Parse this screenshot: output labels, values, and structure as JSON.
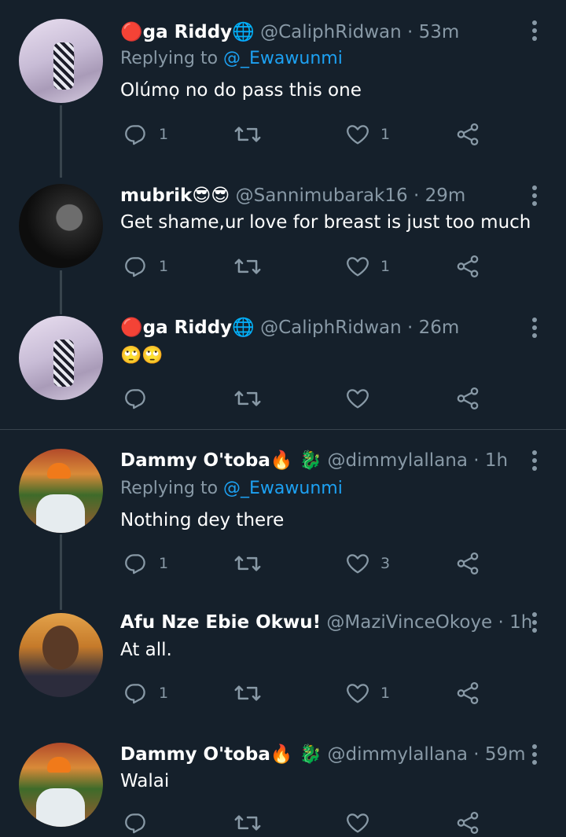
{
  "tweets": [
    {
      "name": "🔴ga Riddy🌐",
      "handle": "@CaliphRidwan",
      "time": "· 53m",
      "replying_label": "Replying to",
      "replying_to": "@_Ewawunmi",
      "text": "Olúmọ no do pass this one",
      "replies": "1",
      "retweets": "",
      "likes": "1"
    },
    {
      "name": "mubrik😎😎",
      "handle": "@Sannimubarak16",
      "time": "· 29m",
      "text": "Get shame,ur love for breast is just too much",
      "replies": "1",
      "retweets": "",
      "likes": "1"
    },
    {
      "name": "🔴ga Riddy🌐",
      "handle": "@CaliphRidwan",
      "time": "· 26m",
      "text": "🙄🙄",
      "replies": "",
      "retweets": "",
      "likes": ""
    },
    {
      "name": "Dammy O'toba🔥 🐉",
      "handle": "@dimmylallana",
      "time": "· 1h",
      "replying_label": "Replying to",
      "replying_to": "@_Ewawunmi",
      "text": "Nothing dey there",
      "replies": "1",
      "retweets": "",
      "likes": "3"
    },
    {
      "name": "Afu Nze Ebie Okwu!",
      "handle": "@MaziVinceOkoye",
      "time": "· 1h",
      "text": "At all.",
      "replies": "1",
      "retweets": "",
      "likes": "1"
    },
    {
      "name": "Dammy O'toba🔥 🐉",
      "handle": "@dimmylallana",
      "time": "· 59m",
      "text": "Walai",
      "replies": "",
      "retweets": "",
      "likes": ""
    }
  ],
  "colors": {
    "background": "#15202b",
    "secondary_text": "#8899a6",
    "accent": "#1da1f2",
    "divider": "#38444d"
  },
  "icons": {
    "reply": "reply-icon",
    "retweet": "retweet-icon",
    "like": "heart-icon",
    "share": "share-icon",
    "more": "more-vertical-icon"
  }
}
